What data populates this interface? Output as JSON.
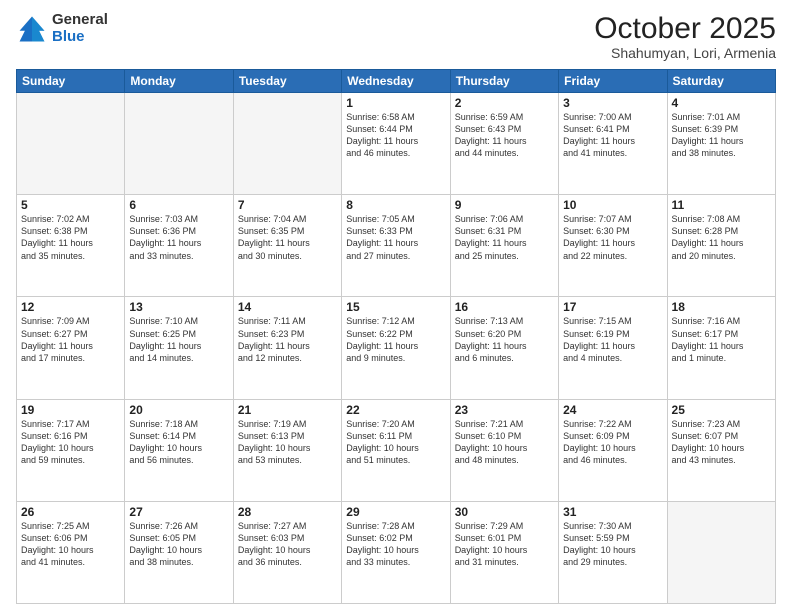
{
  "logo": {
    "general": "General",
    "blue": "Blue"
  },
  "header": {
    "month": "October 2025",
    "location": "Shahumyan, Lori, Armenia"
  },
  "weekdays": [
    "Sunday",
    "Monday",
    "Tuesday",
    "Wednesday",
    "Thursday",
    "Friday",
    "Saturday"
  ],
  "weeks": [
    [
      {
        "day": "",
        "info": ""
      },
      {
        "day": "",
        "info": ""
      },
      {
        "day": "",
        "info": ""
      },
      {
        "day": "1",
        "info": "Sunrise: 6:58 AM\nSunset: 6:44 PM\nDaylight: 11 hours\nand 46 minutes."
      },
      {
        "day": "2",
        "info": "Sunrise: 6:59 AM\nSunset: 6:43 PM\nDaylight: 11 hours\nand 44 minutes."
      },
      {
        "day": "3",
        "info": "Sunrise: 7:00 AM\nSunset: 6:41 PM\nDaylight: 11 hours\nand 41 minutes."
      },
      {
        "day": "4",
        "info": "Sunrise: 7:01 AM\nSunset: 6:39 PM\nDaylight: 11 hours\nand 38 minutes."
      }
    ],
    [
      {
        "day": "5",
        "info": "Sunrise: 7:02 AM\nSunset: 6:38 PM\nDaylight: 11 hours\nand 35 minutes."
      },
      {
        "day": "6",
        "info": "Sunrise: 7:03 AM\nSunset: 6:36 PM\nDaylight: 11 hours\nand 33 minutes."
      },
      {
        "day": "7",
        "info": "Sunrise: 7:04 AM\nSunset: 6:35 PM\nDaylight: 11 hours\nand 30 minutes."
      },
      {
        "day": "8",
        "info": "Sunrise: 7:05 AM\nSunset: 6:33 PM\nDaylight: 11 hours\nand 27 minutes."
      },
      {
        "day": "9",
        "info": "Sunrise: 7:06 AM\nSunset: 6:31 PM\nDaylight: 11 hours\nand 25 minutes."
      },
      {
        "day": "10",
        "info": "Sunrise: 7:07 AM\nSunset: 6:30 PM\nDaylight: 11 hours\nand 22 minutes."
      },
      {
        "day": "11",
        "info": "Sunrise: 7:08 AM\nSunset: 6:28 PM\nDaylight: 11 hours\nand 20 minutes."
      }
    ],
    [
      {
        "day": "12",
        "info": "Sunrise: 7:09 AM\nSunset: 6:27 PM\nDaylight: 11 hours\nand 17 minutes."
      },
      {
        "day": "13",
        "info": "Sunrise: 7:10 AM\nSunset: 6:25 PM\nDaylight: 11 hours\nand 14 minutes."
      },
      {
        "day": "14",
        "info": "Sunrise: 7:11 AM\nSunset: 6:23 PM\nDaylight: 11 hours\nand 12 minutes."
      },
      {
        "day": "15",
        "info": "Sunrise: 7:12 AM\nSunset: 6:22 PM\nDaylight: 11 hours\nand 9 minutes."
      },
      {
        "day": "16",
        "info": "Sunrise: 7:13 AM\nSunset: 6:20 PM\nDaylight: 11 hours\nand 6 minutes."
      },
      {
        "day": "17",
        "info": "Sunrise: 7:15 AM\nSunset: 6:19 PM\nDaylight: 11 hours\nand 4 minutes."
      },
      {
        "day": "18",
        "info": "Sunrise: 7:16 AM\nSunset: 6:17 PM\nDaylight: 11 hours\nand 1 minute."
      }
    ],
    [
      {
        "day": "19",
        "info": "Sunrise: 7:17 AM\nSunset: 6:16 PM\nDaylight: 10 hours\nand 59 minutes."
      },
      {
        "day": "20",
        "info": "Sunrise: 7:18 AM\nSunset: 6:14 PM\nDaylight: 10 hours\nand 56 minutes."
      },
      {
        "day": "21",
        "info": "Sunrise: 7:19 AM\nSunset: 6:13 PM\nDaylight: 10 hours\nand 53 minutes."
      },
      {
        "day": "22",
        "info": "Sunrise: 7:20 AM\nSunset: 6:11 PM\nDaylight: 10 hours\nand 51 minutes."
      },
      {
        "day": "23",
        "info": "Sunrise: 7:21 AM\nSunset: 6:10 PM\nDaylight: 10 hours\nand 48 minutes."
      },
      {
        "day": "24",
        "info": "Sunrise: 7:22 AM\nSunset: 6:09 PM\nDaylight: 10 hours\nand 46 minutes."
      },
      {
        "day": "25",
        "info": "Sunrise: 7:23 AM\nSunset: 6:07 PM\nDaylight: 10 hours\nand 43 minutes."
      }
    ],
    [
      {
        "day": "26",
        "info": "Sunrise: 7:25 AM\nSunset: 6:06 PM\nDaylight: 10 hours\nand 41 minutes."
      },
      {
        "day": "27",
        "info": "Sunrise: 7:26 AM\nSunset: 6:05 PM\nDaylight: 10 hours\nand 38 minutes."
      },
      {
        "day": "28",
        "info": "Sunrise: 7:27 AM\nSunset: 6:03 PM\nDaylight: 10 hours\nand 36 minutes."
      },
      {
        "day": "29",
        "info": "Sunrise: 7:28 AM\nSunset: 6:02 PM\nDaylight: 10 hours\nand 33 minutes."
      },
      {
        "day": "30",
        "info": "Sunrise: 7:29 AM\nSunset: 6:01 PM\nDaylight: 10 hours\nand 31 minutes."
      },
      {
        "day": "31",
        "info": "Sunrise: 7:30 AM\nSunset: 5:59 PM\nDaylight: 10 hours\nand 29 minutes."
      },
      {
        "day": "",
        "info": ""
      }
    ]
  ]
}
